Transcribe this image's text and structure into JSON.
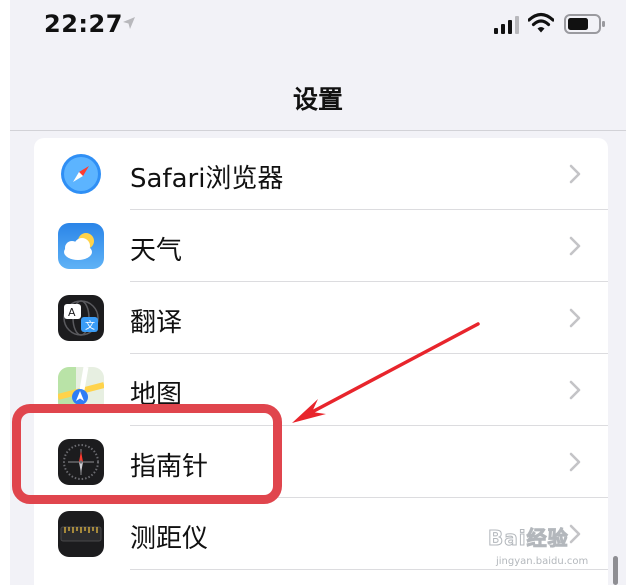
{
  "status_bar": {
    "time": "22:27",
    "icons": [
      "location-arrow-icon",
      "cellular-signal-icon",
      "wifi-icon",
      "battery-icon"
    ]
  },
  "nav": {
    "title": "设置"
  },
  "settings_list": {
    "items": [
      {
        "label": "Safari浏览器",
        "icon": "safari-icon"
      },
      {
        "label": "天气",
        "icon": "weather-icon"
      },
      {
        "label": "翻译",
        "icon": "translate-icon"
      },
      {
        "label": "地图",
        "icon": "maps-icon"
      },
      {
        "label": "指南针",
        "icon": "compass-icon"
      },
      {
        "label": "测距仪",
        "icon": "measure-icon"
      }
    ]
  },
  "annotation": {
    "highlighted_item": "指南针",
    "color": "#e0454d"
  },
  "watermark": {
    "brand": "Bai经验",
    "url": "jingyan.baidu.com"
  }
}
